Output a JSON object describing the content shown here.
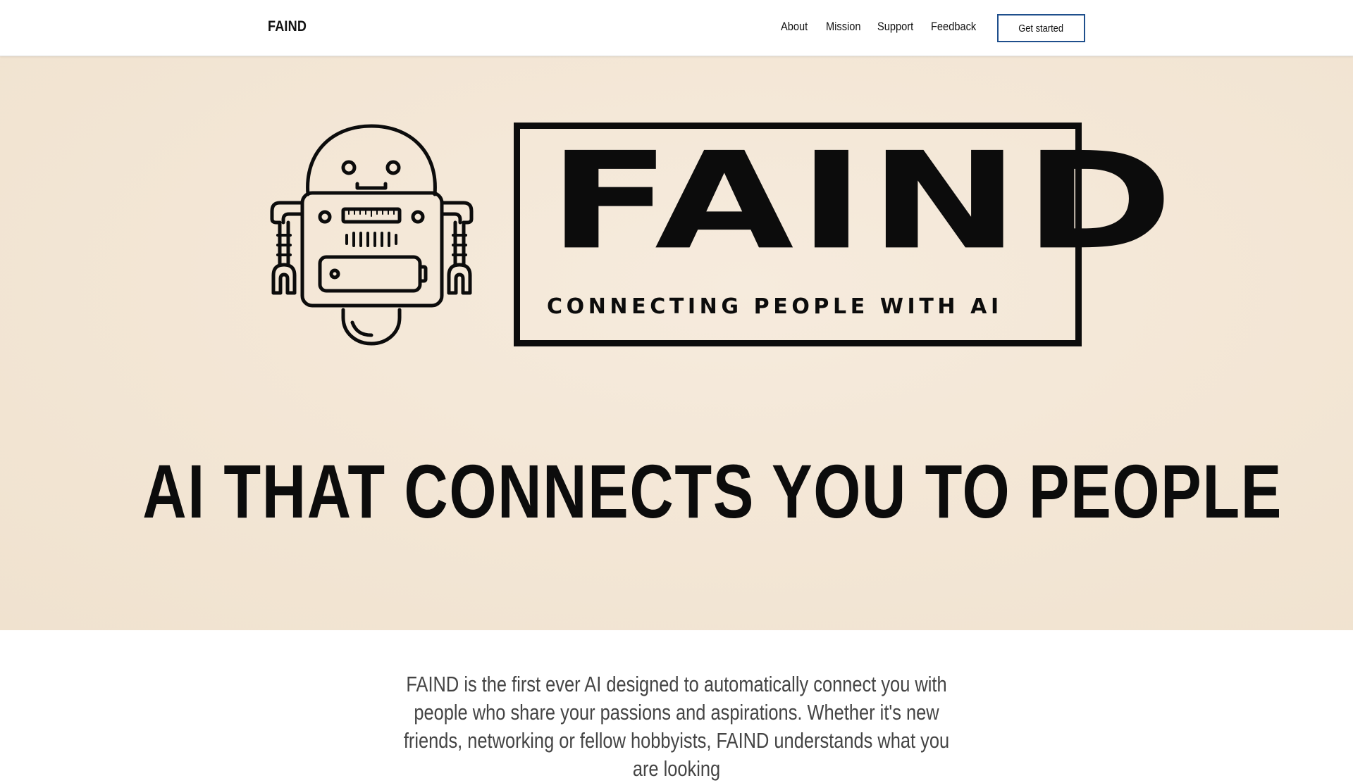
{
  "header": {
    "brand": "FAIND",
    "nav": [
      "About",
      "Mission",
      "Support",
      "Feedback"
    ],
    "cta_label": "Get started",
    "cta_border_color": "#1f4f8c"
  },
  "hero": {
    "logo_word": "FAIND",
    "logo_tagline": "CONNECTING PEOPLE WITH AI",
    "headline": "AI THAT CONNECTS YOU TO PEOPLE",
    "background_color": "#f3e6d5",
    "robot_icon": "robot-icon"
  },
  "intro": {
    "text": "FAIND is the first ever AI designed to automatically connect you with people who share your passions and aspirations. Whether it's new friends, networking or fellow hobbyists, FAIND understands what you are looking"
  }
}
